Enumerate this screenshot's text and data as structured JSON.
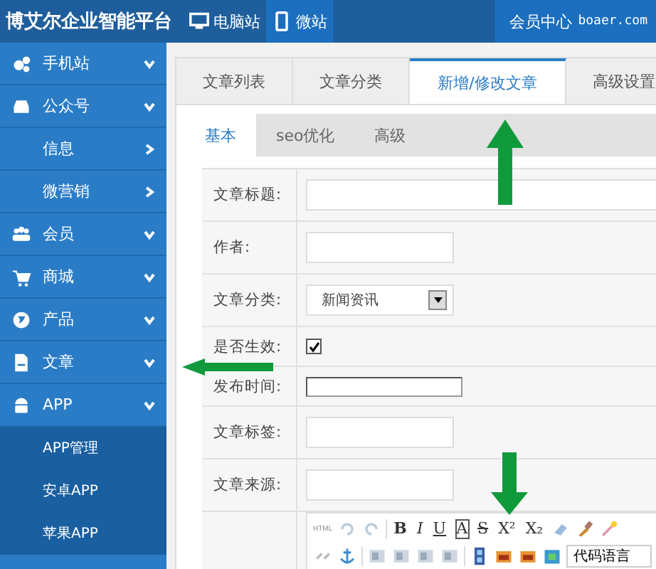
{
  "header": {
    "title": "博艾尔企业智能平台",
    "sites": [
      {
        "label": "电脑站",
        "selected": false
      },
      {
        "label": "微站",
        "selected": true
      }
    ],
    "member": "会员中心",
    "domain": "boaer.com"
  },
  "sidebar": {
    "items": [
      {
        "label": "手机站",
        "kind": "top"
      },
      {
        "label": "公众号",
        "kind": "top",
        "children": [
          {
            "label": "信息",
            "kind": "sub"
          },
          {
            "label": "微营销",
            "kind": "sub"
          }
        ]
      },
      {
        "label": "会员",
        "kind": "top"
      },
      {
        "label": "商城",
        "kind": "top"
      },
      {
        "label": "产品",
        "kind": "top"
      },
      {
        "label": "文章",
        "kind": "top"
      },
      {
        "label": "APP",
        "kind": "top",
        "children": [
          {
            "label": "APP管理",
            "kind": "leaf"
          },
          {
            "label": "安卓APP",
            "kind": "leaf"
          },
          {
            "label": "苹果APP",
            "kind": "leaf"
          }
        ]
      }
    ]
  },
  "tabs": [
    {
      "label": "文章列表",
      "selected": false
    },
    {
      "label": "文章分类",
      "selected": false
    },
    {
      "label": "新增/修改文章",
      "selected": true
    },
    {
      "label": "高级设置",
      "selected": false
    }
  ],
  "subtabs": [
    {
      "label": "基本",
      "selected": true
    },
    {
      "label": "seo优化",
      "selected": false
    },
    {
      "label": "高级",
      "selected": false
    }
  ],
  "form": [
    {
      "label": "文章标题:",
      "kind": "wide"
    },
    {
      "label": "作者:",
      "kind": "text"
    },
    {
      "label": "文章分类:",
      "kind": "select",
      "value": "新闻资讯"
    },
    {
      "label": "是否生效:",
      "kind": "checkbox",
      "checked": true
    },
    {
      "label": "发布时间:",
      "kind": "date"
    },
    {
      "label": "文章标签:",
      "kind": "text"
    },
    {
      "label": "文章来源:",
      "kind": "text"
    }
  ],
  "editor": {
    "html_button": "HTML",
    "format_buttons": [
      "B",
      "I",
      "U",
      "A",
      "S",
      "X²",
      "X₂"
    ],
    "code_language": "代码语言"
  }
}
